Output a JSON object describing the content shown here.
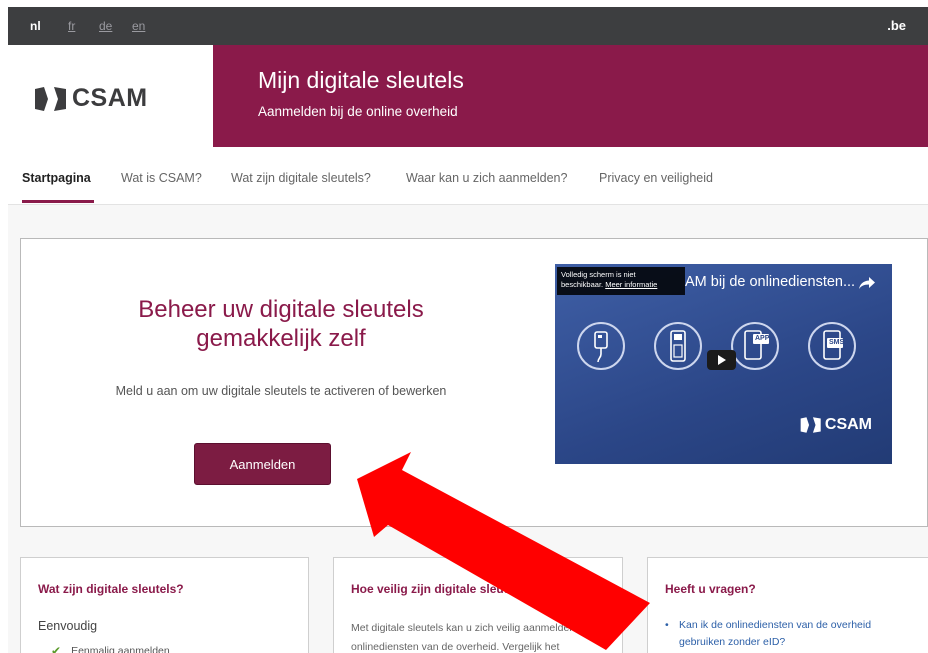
{
  "languages": [
    "nl",
    "fr",
    "de",
    "en"
  ],
  "top_right": ".be",
  "logo": {
    "text": "CSAM"
  },
  "header": {
    "title": "Mijn digitale sleutels",
    "subtitle": "Aanmelden bij de online overheid"
  },
  "nav": [
    "Startpagina",
    "Wat is CSAM?",
    "Wat zijn digitale sleutels?",
    "Waar kan u zich aanmelden?",
    "Privacy en veiligheid"
  ],
  "hero": {
    "title_line1": "Beheer uw digitale sleutels",
    "title_line2": "gemakkelijk zelf",
    "description": "Meld u aan om uw digitale sleutels te activeren of bewerken",
    "button": "Aanmelden"
  },
  "video": {
    "tooltip_line1": "Volledig scherm is niet",
    "tooltip_line2": "beschikbaar.",
    "tooltip_link": "Meer informatie",
    "title": "AM bij de onlinediensten...",
    "badges": [
      "APP",
      "SMS"
    ],
    "logo_text": "CSAM"
  },
  "cards": {
    "card1": {
      "title": "Wat zijn digitale sleutels?",
      "subtitle": "Eenvoudig",
      "item": "Eenmalig aanmelden"
    },
    "card2": {
      "title": "Hoe veilig zijn digitale sleutels?",
      "text": "Met digitale sleutels kan u zich veilig aanmelden bij onlinediensten van de overheid. Vergelijk het"
    },
    "card3": {
      "title": "Heeft u vragen?",
      "link": "Kan ik de onlinediensten van de overheid gebruiken zonder eID?"
    }
  },
  "colors": {
    "brand": "#8a1a4a",
    "topbar": "#3d3e40",
    "arrow": "#ff0000",
    "video_bg": "#2b4687"
  }
}
